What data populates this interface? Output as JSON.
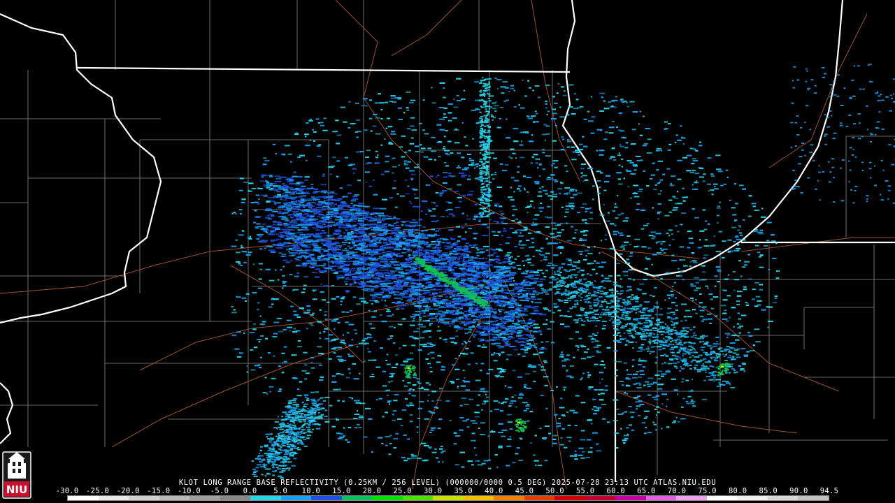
{
  "product": {
    "caption": "KLOT LONG RANGE BASE REFLECTIVITY (0.25KM / 256 LEVEL) (000000/0000 0.5 DEG) 2025-07-28 23:13 UTC  ATLAS.NIU.EDU"
  },
  "colorbar": {
    "labels": [
      "-30.0",
      "-25.0",
      "-20.0",
      "-15.0",
      "-10.0",
      "-5.0",
      "0.0",
      "5.0",
      "10.0",
      "15.0",
      "20.0",
      "25.0",
      "30.0",
      "35.0",
      "40.0",
      "45.0",
      "50.0",
      "55.0",
      "60.0",
      "65.0",
      "70.0",
      "75.0",
      "80.0",
      "85.0",
      "90.0",
      "94.5"
    ],
    "colors": [
      "#ffffff",
      "#e8e8e8",
      "#d0d0d0",
      "#b8b8b8",
      "#a0a0a0",
      "#888888",
      "#2ad4e8",
      "#1aa0f0",
      "#2050e0",
      "#10c060",
      "#00e000",
      "#50e000",
      "#c8e000",
      "#f0c000",
      "#f08000",
      "#e04000",
      "#d00000",
      "#c00030",
      "#c000a0",
      "#e060e0",
      "#f0a0f0",
      "#ffffff",
      "#f0f0f0",
      "#d8d8d8",
      "#c0c0c0"
    ]
  },
  "logo": {
    "text": "NIU",
    "icon": "niu-tower-logo"
  },
  "map": {
    "radar_site": "KLOT",
    "colors": {
      "state_border": "#ffffff",
      "county_border": "#8a8a8a",
      "road": "#a0522d",
      "echo_light": "#2ad4e8",
      "echo_mid": "#1aa0f0",
      "echo_deep": "#2050e0",
      "echo_green": "#10c050"
    }
  }
}
